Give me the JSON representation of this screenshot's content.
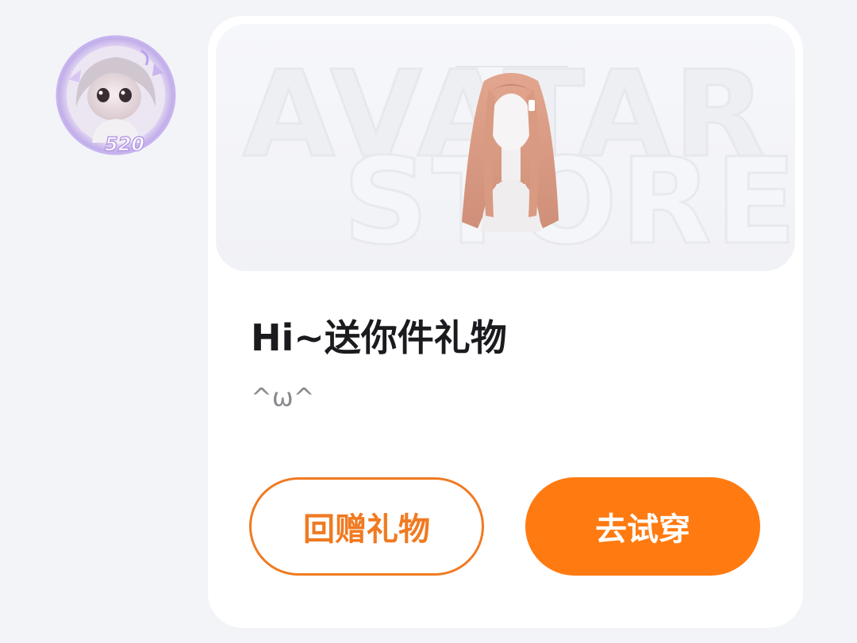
{
  "sender": {
    "avatar_icon": "doll-avatar-icon",
    "frame_badge": "520"
  },
  "gift_card": {
    "banner": {
      "watermark_line1": "AVATAR",
      "watermark_line2": "STORE",
      "item_icon": "long-hair-wig-icon"
    },
    "title": "Hi~送你件礼物",
    "subtitle": "^ω^",
    "buttons": {
      "return_gift": "回赠礼物",
      "try_on": "去试穿"
    },
    "colors": {
      "accent": "#ff7a10",
      "accent_border": "#f07a22",
      "card_bg": "#ffffff",
      "page_bg": "#f3f4f8"
    }
  }
}
